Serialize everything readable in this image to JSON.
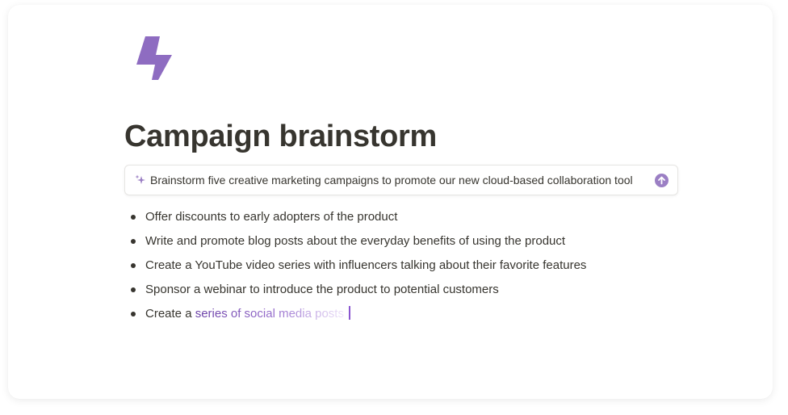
{
  "page": {
    "title": "Campaign brainstorm",
    "icon": "lightning-bolt-icon",
    "accent_color": "#8e6cc1"
  },
  "ai_prompt": {
    "icon": "sparkle-icon",
    "text": "Brainstorm five creative marketing campaigns to promote our new cloud-based collaboration tool",
    "submit_icon": "arrow-up-circle-icon"
  },
  "list": {
    "items": [
      "Offer discounts to early adopters of the product",
      "Write and promote blog posts about the everyday benefits of using the product",
      "Create a YouTube video series with influencers talking about their favorite features",
      "Sponsor a webinar to introduce the product to potential customers"
    ],
    "streaming_item": {
      "solid_text": "Create a ",
      "fading_text": "series of social media posts"
    }
  }
}
